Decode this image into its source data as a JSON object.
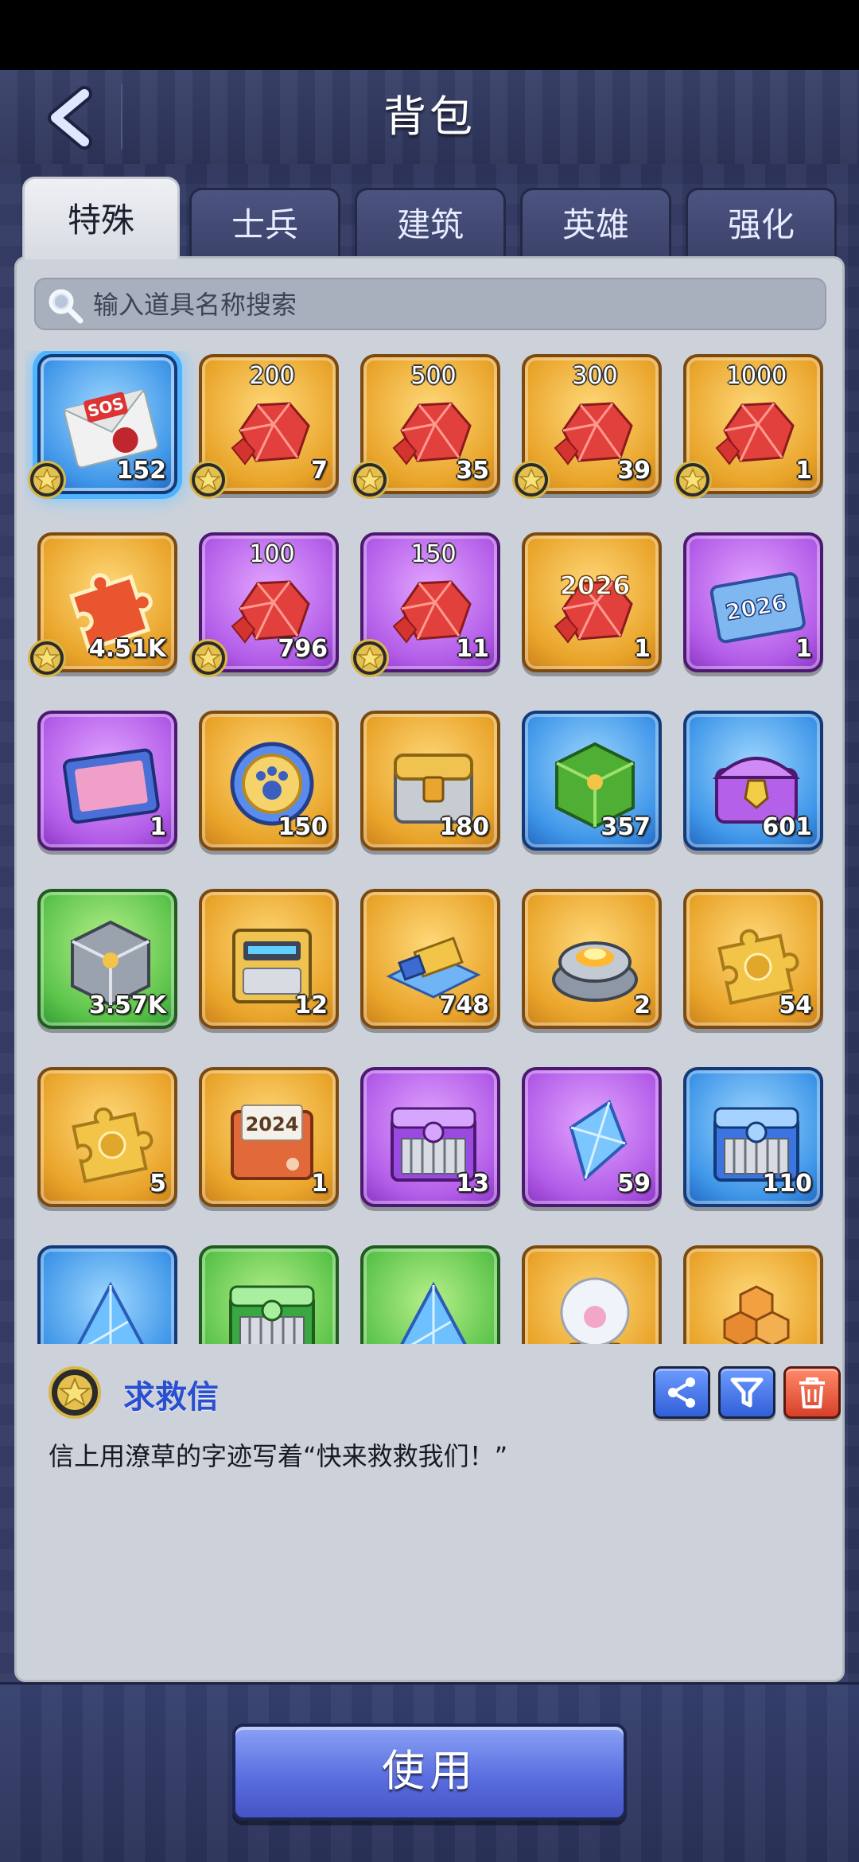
{
  "header": {
    "title": "背包"
  },
  "tabs": [
    "特殊",
    "士兵",
    "建筑",
    "英雄",
    "强化"
  ],
  "active_tab": "特殊",
  "search": {
    "placeholder": "输入道具名称搜索",
    "value": ""
  },
  "items": [
    {
      "name": "求救信",
      "art": "envelope",
      "art_label": "SOS",
      "label": "",
      "count": "152",
      "rarity": "blue",
      "star": true,
      "selected": true
    },
    {
      "name": "gems",
      "art": "gem",
      "label": "200",
      "count": "7",
      "rarity": "gold",
      "star": true
    },
    {
      "name": "gems",
      "art": "gem",
      "label": "500",
      "count": "35",
      "rarity": "gold",
      "star": true
    },
    {
      "name": "gems",
      "art": "gem",
      "label": "300",
      "count": "39",
      "rarity": "gold",
      "star": true
    },
    {
      "name": "gems",
      "art": "gem",
      "label": "1000",
      "count": "1",
      "rarity": "gold",
      "star": true
    },
    {
      "name": "puzzle-red",
      "art": "puzzle-red",
      "label": "",
      "count": "4.51K",
      "rarity": "gold",
      "star": true
    },
    {
      "name": "gems",
      "art": "gem",
      "label": "100",
      "count": "796",
      "rarity": "purple",
      "star": true
    },
    {
      "name": "gems",
      "art": "gem",
      "label": "150",
      "count": "11",
      "rarity": "purple",
      "star": true
    },
    {
      "name": "gems-2026",
      "art": "gem",
      "art_label": "2026",
      "label": "",
      "count": "1",
      "rarity": "gold",
      "star": false
    },
    {
      "name": "ticket-2026",
      "art": "ticket",
      "art_label": "2026",
      "label": "",
      "count": "1",
      "rarity": "purple",
      "star": false
    },
    {
      "name": "card-pack",
      "art": "card",
      "label": "",
      "count": "1",
      "rarity": "purple",
      "star": false
    },
    {
      "name": "paw-coin",
      "art": "coin",
      "label": "",
      "count": "150",
      "rarity": "gold",
      "star": false
    },
    {
      "name": "gold-chest",
      "art": "chest-gold",
      "label": "",
      "count": "180",
      "rarity": "gold",
      "star": false
    },
    {
      "name": "green-cube",
      "art": "cube-green",
      "label": "",
      "count": "357",
      "rarity": "blue",
      "star": false
    },
    {
      "name": "purple-chest",
      "art": "chest-purple",
      "label": "",
      "count": "601",
      "rarity": "blue",
      "star": false
    },
    {
      "name": "steel-cube",
      "art": "cube-steel",
      "label": "",
      "count": "3.57K",
      "rarity": "green",
      "star": false
    },
    {
      "name": "gold-crate",
      "art": "crate",
      "label": "",
      "count": "12",
      "rarity": "gold",
      "star": false
    },
    {
      "name": "truck",
      "art": "truck",
      "label": "",
      "count": "748",
      "rarity": "gold",
      "star": false
    },
    {
      "name": "reactor",
      "art": "reactor",
      "label": "",
      "count": "2",
      "rarity": "gold",
      "star": false
    },
    {
      "name": "puzzle-gold",
      "art": "puzzle-gold",
      "label": "",
      "count": "54",
      "rarity": "gold",
      "star": false
    },
    {
      "name": "puzzle-gold-2",
      "art": "puzzle-gold",
      "label": "",
      "count": "5",
      "rarity": "gold",
      "star": false
    },
    {
      "name": "folder-2024",
      "art": "folder",
      "art_label": "2024",
      "label": "",
      "count": "1",
      "rarity": "gold",
      "star": false
    },
    {
      "name": "purple-crate",
      "art": "crate-purple",
      "label": "",
      "count": "13",
      "rarity": "purple",
      "star": false
    },
    {
      "name": "blue-crystal",
      "art": "crystal",
      "label": "",
      "count": "59",
      "rarity": "purple",
      "star": false
    },
    {
      "name": "blue-crate",
      "art": "crate-blue",
      "label": "",
      "count": "110",
      "rarity": "blue",
      "star": false
    },
    {
      "name": "prism",
      "art": "prism",
      "label": "",
      "count": "",
      "rarity": "blue",
      "star": false
    },
    {
      "name": "green-crate",
      "art": "crate-green",
      "label": "",
      "count": "",
      "rarity": "green",
      "star": false
    },
    {
      "name": "blue-shard",
      "art": "prism",
      "label": "",
      "count": "",
      "rarity": "green",
      "star": false
    },
    {
      "name": "snow-globe",
      "art": "globe",
      "label": "",
      "count": "",
      "rarity": "gold",
      "star": false
    },
    {
      "name": "hex-blocks",
      "art": "hex",
      "label": "",
      "count": "",
      "rarity": "gold",
      "star": false
    }
  ],
  "detail": {
    "name": "求救信",
    "description": "信上用潦草的字迹写着“快来救救我们！”"
  },
  "actions": {
    "use_label": "使用"
  },
  "colors": {
    "gold": "#e9a42a",
    "purple": "#b25ce8",
    "blue": "#3f96e8",
    "green": "#5cc44a",
    "selected_glow": "#4fb4ff"
  }
}
